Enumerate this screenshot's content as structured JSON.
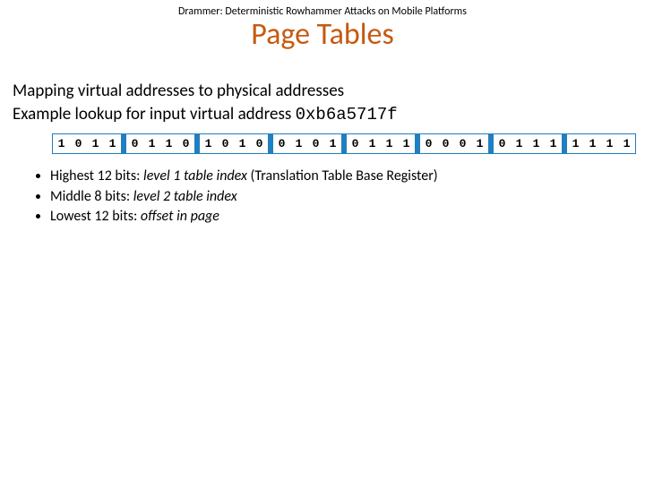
{
  "header": "Drammer: Deterministic Rowhammer Attacks on Mobile Platforms",
  "title": "Page Tables",
  "intro_line1": "Mapping virtual addresses to physical addresses",
  "intro_line2a": "Example lookup for input virtual address ",
  "intro_line2b": "0xb6a5717f",
  "bit_groups": [
    [
      "1",
      "0",
      "1",
      "1"
    ],
    [
      "0",
      "1",
      "1",
      "0"
    ],
    [
      "1",
      "0",
      "1",
      "0"
    ],
    [
      "0",
      "1",
      "0",
      "1"
    ],
    [
      "0",
      "1",
      "1",
      "1"
    ],
    [
      "0",
      "0",
      "0",
      "1"
    ],
    [
      "0",
      "1",
      "1",
      "1"
    ],
    [
      "1",
      "1",
      "1",
      "1"
    ]
  ],
  "bullets": [
    {
      "pre": "Highest 12 bits: ",
      "em": "level 1 table index",
      "post": " (Translation Table Base Register)"
    },
    {
      "pre": "Middle 8 bits: ",
      "em": "level 2 table index",
      "post": ""
    },
    {
      "pre": "Lowest 12 bits: ",
      "em": "offset in page",
      "post": ""
    }
  ]
}
